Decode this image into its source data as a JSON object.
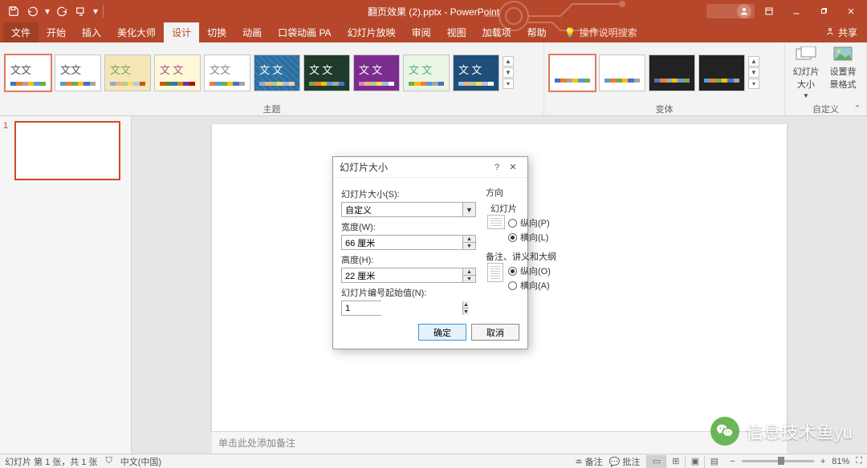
{
  "titlebar": {
    "doc_title": "翻页效果 (2).pptx  -  PowerPoint"
  },
  "ribbon": {
    "tabs": [
      "文件",
      "开始",
      "插入",
      "美化大师",
      "设计",
      "切换",
      "动画",
      "口袋动画 PA",
      "幻灯片放映",
      "审阅",
      "视图",
      "加载项",
      "帮助"
    ],
    "active_tab_index": 4,
    "tell_me": "操作说明搜索",
    "share": "共享",
    "group_themes": "主题",
    "group_variants": "变体",
    "group_custom": "自定义",
    "btn_slide_size": "幻灯片大小",
    "btn_format_bg": "设置背景格式"
  },
  "editor": {
    "slide_number": "1",
    "notes_placeholder": "单击此处添加备注"
  },
  "statusbar": {
    "slide_info": "幻灯片 第 1 张，共 1 张",
    "lang": "中文(中国)",
    "notes_btn": "备注",
    "comments_btn": "批注",
    "zoom": "81%"
  },
  "dialog": {
    "title": "幻灯片大小",
    "size_label": "幻灯片大小(S):",
    "size_value": "自定义",
    "width_label": "宽度(W):",
    "width_value": "66 厘米",
    "height_label": "高度(H):",
    "height_value": "22 厘米",
    "numfrom_label": "幻灯片编号起始值(N):",
    "numfrom_value": "1",
    "orientation_title": "方向",
    "slides_legend": "幻灯片",
    "portrait": "纵向(P)",
    "landscape": "横向(L)",
    "handouts_legend": "备注、讲义和大纲",
    "portrait2": "纵向(O)",
    "landscape2": "横向(A)",
    "ok": "确定",
    "cancel": "取消"
  },
  "watermark": {
    "text": "信息技术鱼yu"
  },
  "theme_thumbs": [
    {
      "bg": "#ffffff",
      "title": "文文",
      "tcol": "#555",
      "colors": [
        "#4472c4",
        "#ed7d31",
        "#a5a5a5",
        "#ffc000",
        "#5b9bd5",
        "#70ad47"
      ]
    },
    {
      "bg": "#ffffff",
      "title": "文文",
      "tcol": "#555",
      "colors": [
        "#5b9bd5",
        "#ed7d31",
        "#70ad47",
        "#ffc000",
        "#4472c4",
        "#a5a5a5"
      ]
    },
    {
      "bg": "#f5e6b8",
      "title": "文文",
      "tcol": "#7a5",
      "colors": [
        "#8faadc",
        "#f4b183",
        "#a9d18e",
        "#ffd966",
        "#b4c7e7",
        "#c55a11"
      ]
    },
    {
      "bg": "#fff8d8",
      "title": "文 文",
      "tcol": "#a58",
      "colors": [
        "#c55a11",
        "#548235",
        "#2e75b6",
        "#bf9000",
        "#7030a0",
        "#c00000"
      ]
    },
    {
      "bg": "#ffffff",
      "title": "文文",
      "tcol": "#888",
      "colors": [
        "#ed7d31",
        "#5b9bd5",
        "#70ad47",
        "#ffc000",
        "#4472c4",
        "#a5a5a5"
      ]
    },
    {
      "bg": "#2e6e9e",
      "title": "文 文",
      "tcol": "#fff",
      "colors": [
        "#8faadc",
        "#f4b183",
        "#a9d18e",
        "#ffd966",
        "#9dc3e6",
        "#f8cbad"
      ],
      "pattern": true
    },
    {
      "bg": "#1f3b2b",
      "title": "文 文",
      "tcol": "#fff",
      "colors": [
        "#70ad47",
        "#ed7d31",
        "#ffc000",
        "#5b9bd5",
        "#a5a5a5",
        "#4472c4"
      ]
    },
    {
      "bg": "#7b2d8e",
      "title": "文 文",
      "tcol": "#fff",
      "colors": [
        "#d883c6",
        "#f4b183",
        "#a9d18e",
        "#ffd966",
        "#9dc3e6",
        "#ffffff"
      ]
    },
    {
      "bg": "#eaf5e4",
      "title": "文 文",
      "tcol": "#5a8",
      "colors": [
        "#70ad47",
        "#ffc000",
        "#ed7d31",
        "#5b9bd5",
        "#a5a5a5",
        "#4472c4"
      ]
    },
    {
      "bg": "#1e4e79",
      "title": "文 文",
      "tcol": "#fff",
      "colors": [
        "#9dc3e6",
        "#f4b183",
        "#a9d18e",
        "#ffd966",
        "#b4c7e7",
        "#ffffff"
      ]
    }
  ],
  "variant_thumbs": [
    {
      "bg": "#ffffff",
      "sel": true,
      "colors": [
        "#4472c4",
        "#ed7d31",
        "#a5a5a5",
        "#ffc000",
        "#5b9bd5",
        "#70ad47"
      ]
    },
    {
      "bg": "#ffffff",
      "colors": [
        "#5b9bd5",
        "#ed7d31",
        "#70ad47",
        "#ffc000",
        "#4472c4",
        "#a5a5a5"
      ]
    },
    {
      "bg": "#222222",
      "colors": [
        "#4472c4",
        "#ed7d31",
        "#a5a5a5",
        "#ffc000",
        "#5b9bd5",
        "#70ad47"
      ]
    },
    {
      "bg": "#222222",
      "colors": [
        "#5b9bd5",
        "#ed7d31",
        "#70ad47",
        "#ffc000",
        "#4472c4",
        "#a5a5a5"
      ]
    }
  ]
}
